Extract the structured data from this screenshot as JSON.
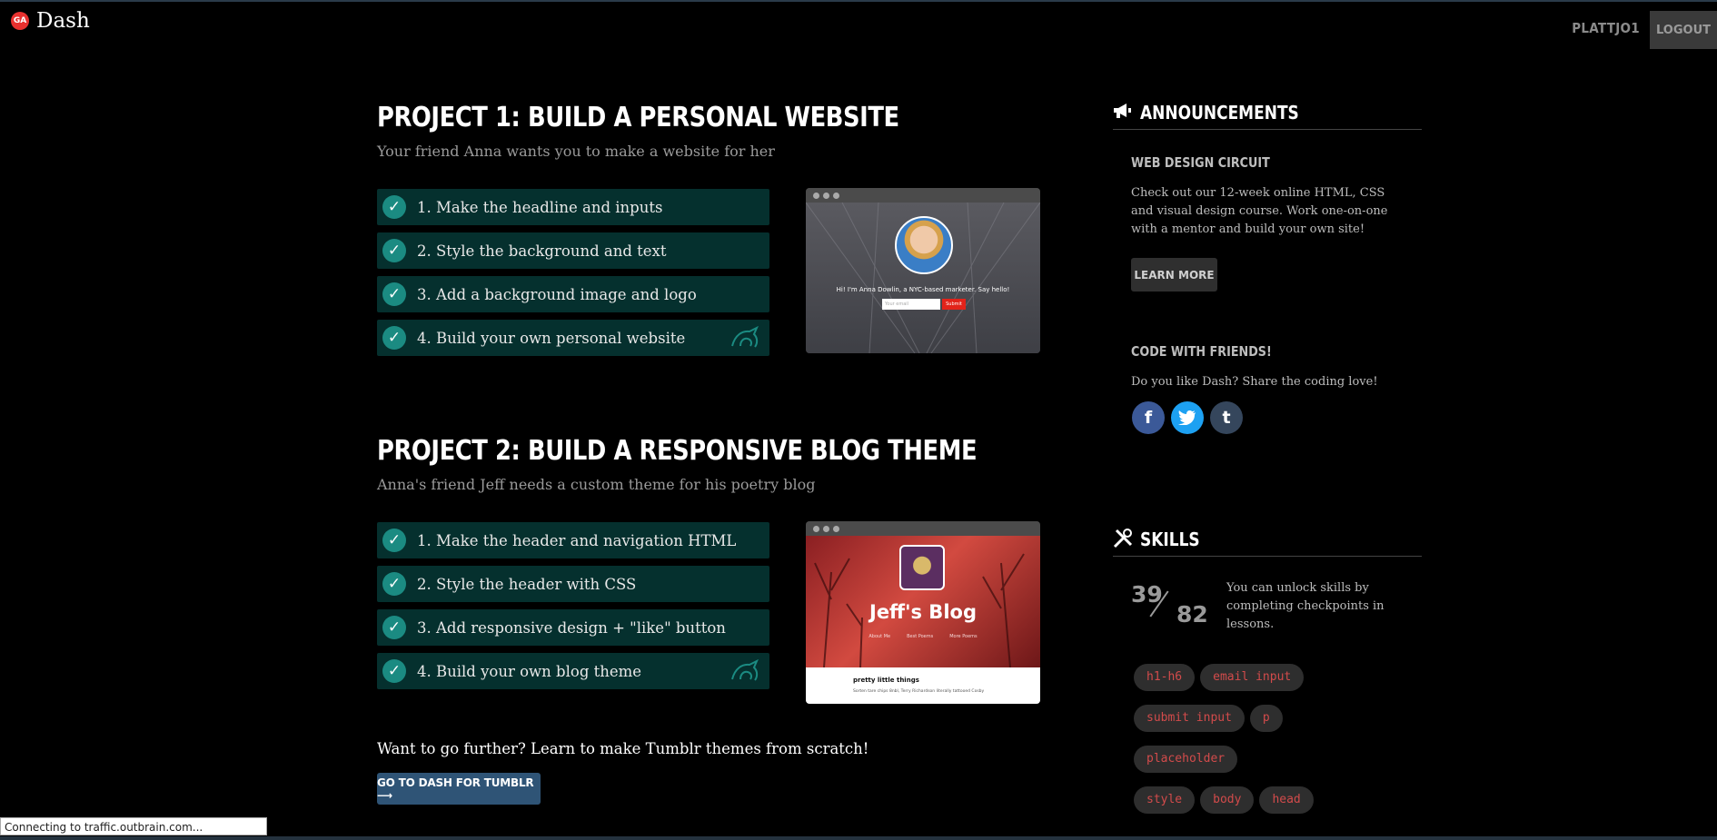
{
  "header": {
    "logo_badge": "GA",
    "logo_text": "Dash",
    "username": "PLATTJO1",
    "logout_label": "LOGOUT"
  },
  "project1": {
    "title": "PROJECT 1: BUILD A PERSONAL WEBSITE",
    "subtitle": "Your friend Anna wants you to make a website for her",
    "steps": [
      {
        "label": "1. Make the headline and inputs",
        "done": true
      },
      {
        "label": "2. Style the background and text",
        "done": true
      },
      {
        "label": "3. Add a background image and logo",
        "done": true
      },
      {
        "label": "4. Build your own personal website",
        "done": true
      }
    ],
    "preview": {
      "intro": "Hi! I'm Anna Dowlin, a NYC-based marketer. Say hello!",
      "email_placeholder": "Your email",
      "submit": "Submit"
    }
  },
  "project2": {
    "title": "PROJECT 2: BUILD A RESPONSIVE BLOG THEME",
    "subtitle": "Anna's friend Jeff needs a custom theme for his poetry blog",
    "steps": [
      {
        "label": "1. Make the header and navigation HTML",
        "done": true
      },
      {
        "label": "2. Style the header with CSS",
        "done": true
      },
      {
        "label": "3. Add responsive design + \"like\" button",
        "done": true
      },
      {
        "label": "4. Build your own blog theme",
        "done": true
      }
    ],
    "preview": {
      "blog_title": "Jeff's Blog",
      "nav": [
        "About Me",
        "Best Poems",
        "More Poems"
      ],
      "post_title": "pretty little things",
      "post_text": "Sorten tare chips 8nbl, Terry Richardson literally tattooed Cosby"
    }
  },
  "further": {
    "text": "Want to go further? Learn to make Tumblr themes from scratch!",
    "button": "GO TO DASH FOR TUMBLR ⟶"
  },
  "sidebar": {
    "announcements": {
      "title": "ANNOUNCEMENTS",
      "circuit_title": "WEB DESIGN CIRCUIT",
      "circuit_text": "Check out our 12-week online HTML, CSS and visual design course. Work one-on-one with a mentor and build your own site!",
      "learn_more": "LEARN MORE",
      "friends_title": "CODE WITH FRIENDS!",
      "friends_text": "Do you like Dash? Share the coding love!",
      "social": [
        {
          "name": "facebook",
          "glyph": "f",
          "color": "#3b5998"
        },
        {
          "name": "twitter",
          "glyph": "t",
          "color": "#1da1f2"
        },
        {
          "name": "tumblr",
          "glyph": "t",
          "color": "#35465c"
        }
      ]
    },
    "skills": {
      "title": "SKILLS",
      "unlocked": "39",
      "total": "82",
      "text": "You can unlock skills by completing checkpoints in lessons.",
      "tags": [
        "h1-h6",
        "email input",
        "submit input",
        "p",
        "placeholder",
        "style",
        "body",
        "head"
      ]
    }
  },
  "statusbar": {
    "text": "Connecting to traffic.outbrain.com..."
  },
  "colors": {
    "step_bg": "#05302e",
    "check": "#1b8b82",
    "tag_text": "#d24b4b",
    "tumblr_btn": "#2f5476"
  }
}
